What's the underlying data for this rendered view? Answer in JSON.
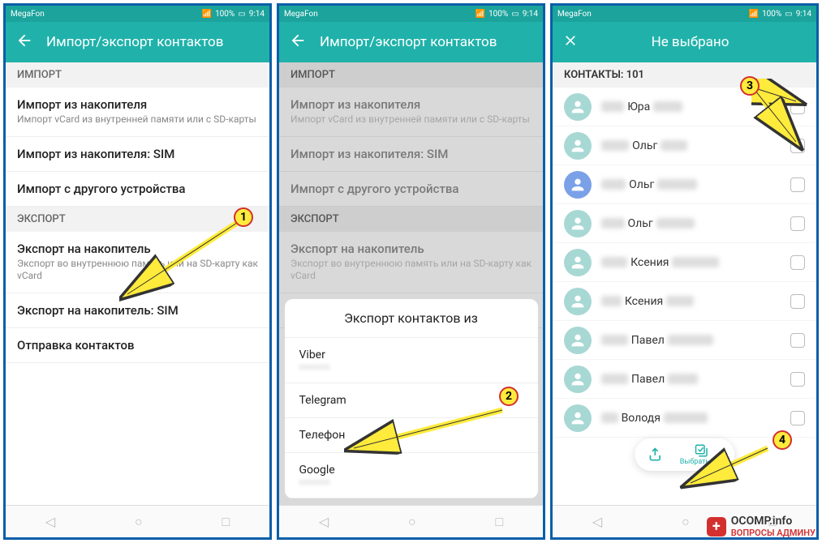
{
  "status": {
    "carrier": "MegaFon",
    "battery": "100%",
    "time": "9:14"
  },
  "screen1": {
    "title": "Импорт/экспорт контактов",
    "sections": {
      "import": {
        "header": "ИМПОРТ",
        "items": [
          {
            "primary": "Импорт из накопителя",
            "secondary": "Импорт vCard из внутренней памяти или с SD-карты"
          },
          {
            "primary": "Импорт из накопителя: SIM"
          },
          {
            "primary": "Импорт с другого устройства"
          }
        ]
      },
      "export": {
        "header": "ЭКСПОРТ",
        "items": [
          {
            "primary": "Экспорт на накопитель",
            "secondary": "Экспорт во внутреннюю память или на SD-карту как vCard"
          },
          {
            "primary": "Экспорт на накопитель: SIM"
          },
          {
            "primary": "Отправка контактов"
          }
        ]
      }
    }
  },
  "screen2": {
    "title": "Импорт/экспорт контактов",
    "dialog": {
      "title": "Экспорт контактов из",
      "options": [
        "Viber",
        "Telegram",
        "Телефон",
        "Google"
      ]
    }
  },
  "screen3": {
    "title": "Не выбрано",
    "contacts_label": "КОНТАКТЫ: 101",
    "contacts": [
      {
        "name": "Юра",
        "av": "#a7d8d4"
      },
      {
        "name": "Ольг",
        "av": "#a7d8d4"
      },
      {
        "name": "Ольг",
        "av": "#7aa0e8"
      },
      {
        "name": "Ольг",
        "av": "#a7d8d4"
      },
      {
        "name": "Ксения",
        "av": "#a7d8d4"
      },
      {
        "name": "Ксения",
        "av": "#a7d8d4"
      },
      {
        "name": "Павел",
        "av": "#a7d8d4"
      },
      {
        "name": "Павел",
        "av": "#a7d8d4"
      },
      {
        "name": "Володя",
        "av": "#a7d8d4"
      }
    ],
    "select_all": "Выбрать все"
  },
  "watermark": {
    "top": "OCOMP.info",
    "bot": "ВОПРОСЫ АДМИНУ"
  },
  "annotations": [
    "1",
    "2",
    "3",
    "4"
  ]
}
